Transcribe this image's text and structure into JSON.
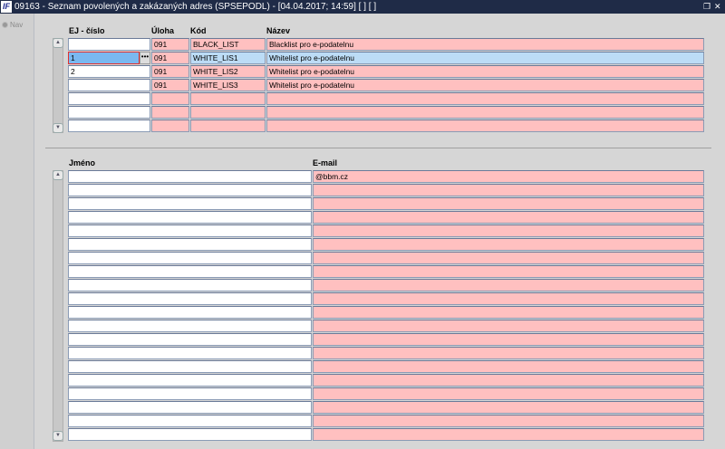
{
  "window": {
    "title": "09163 - Seznam povolených a zakázaných adres (SPSEPODL) - [04.04.2017; 14:59]  [ ]  [ ]",
    "logo": "IF",
    "restore_icon": "restore-icon",
    "close_icon": "close-icon"
  },
  "nav": {
    "label": "Nav"
  },
  "top_grid": {
    "headers": {
      "ej": "EJ - číslo",
      "uloha": "Úloha",
      "kod": "Kód",
      "nazev": "Název"
    },
    "rows": [
      {
        "ej": "",
        "uloha": "091",
        "kod": "BLACK_LIST",
        "nazev": "Blacklist pro e-podatelnu"
      },
      {
        "ej": "1",
        "uloha": "091",
        "kod": "WHITE_LIS1",
        "nazev": "Whitelist pro e-podatelnu"
      },
      {
        "ej": "2",
        "uloha": "091",
        "kod": "WHITE_LIS2",
        "nazev": "Whitelist pro e-podatelnu"
      },
      {
        "ej": "",
        "uloha": "091",
        "kod": "WHITE_LIS3",
        "nazev": "Whitelist pro e-podatelnu"
      },
      {
        "ej": "",
        "uloha": "",
        "kod": "",
        "nazev": ""
      },
      {
        "ej": "",
        "uloha": "",
        "kod": "",
        "nazev": ""
      },
      {
        "ej": "",
        "uloha": "",
        "kod": "",
        "nazev": ""
      }
    ],
    "selected_row": 1,
    "lov_button": "•••"
  },
  "bottom_grid": {
    "headers": {
      "jmeno": "Jméno",
      "email": "E-mail"
    },
    "rows": [
      {
        "jmeno": "",
        "email": "@bbm.cz"
      },
      {
        "jmeno": "",
        "email": ""
      },
      {
        "jmeno": "",
        "email": ""
      },
      {
        "jmeno": "",
        "email": ""
      },
      {
        "jmeno": "",
        "email": ""
      },
      {
        "jmeno": "",
        "email": ""
      },
      {
        "jmeno": "",
        "email": ""
      },
      {
        "jmeno": "",
        "email": ""
      },
      {
        "jmeno": "",
        "email": ""
      },
      {
        "jmeno": "",
        "email": ""
      },
      {
        "jmeno": "",
        "email": ""
      },
      {
        "jmeno": "",
        "email": ""
      },
      {
        "jmeno": "",
        "email": ""
      },
      {
        "jmeno": "",
        "email": ""
      },
      {
        "jmeno": "",
        "email": ""
      },
      {
        "jmeno": "",
        "email": ""
      },
      {
        "jmeno": "",
        "email": ""
      },
      {
        "jmeno": "",
        "email": ""
      },
      {
        "jmeno": "",
        "email": ""
      },
      {
        "jmeno": "",
        "email": ""
      }
    ]
  },
  "scroll": {
    "up": "▲",
    "down": "▼"
  }
}
